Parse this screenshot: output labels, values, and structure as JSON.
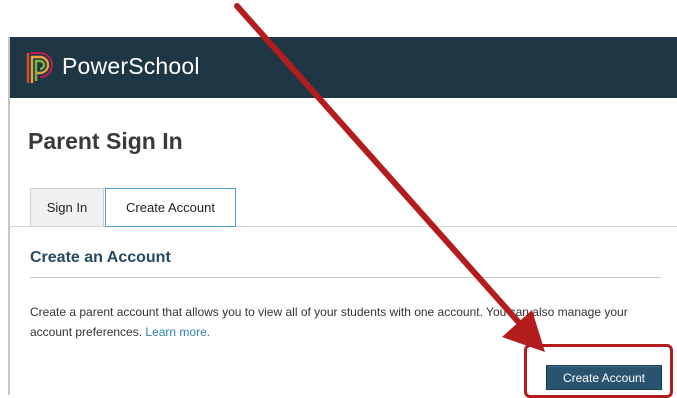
{
  "header": {
    "brand": "PowerSchool",
    "background_color": "#1f3645",
    "logo_icon": "powerschool-logo-icon"
  },
  "page": {
    "title": "Parent Sign In"
  },
  "tabs": [
    {
      "label": "Sign In",
      "active": false
    },
    {
      "label": "Create Account",
      "active": true
    }
  ],
  "section": {
    "title": "Create an Account",
    "description": "Create a parent account that allows you to view all of your students with one account. You can also manage your account preferences. ",
    "link_label": "Learn more."
  },
  "actions": {
    "create_account_label": "Create Account"
  },
  "annotation": {
    "color": "#b31d1d",
    "shapes": [
      "arrow-icon",
      "highlight-box"
    ]
  }
}
